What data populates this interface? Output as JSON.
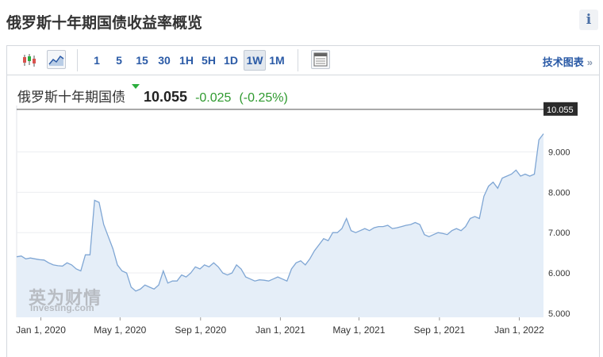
{
  "page_title": "俄罗斯十年期国债收益率概览",
  "info_label": "i",
  "toolbar": {
    "intervals": [
      "1",
      "5",
      "15",
      "30",
      "1H",
      "5H",
      "1D",
      "1W",
      "1M"
    ],
    "active_interval": "1W",
    "tech_chart_label": "技术图表",
    "tech_chart_arrow": "»"
  },
  "quote": {
    "name": "俄罗斯十年期国债",
    "price": "10.055",
    "change": "-0.025",
    "change_pct": "(-0.25%)",
    "change_color": "#2f9a2f"
  },
  "watermark": {
    "cn": "英为财情",
    "en": "Investing.com"
  },
  "chart_data": {
    "type": "area",
    "x_tick_labels": [
      "Jan 1, 2020",
      "May 1, 2020",
      "Sep 1, 2020",
      "Jan 1, 2021",
      "May 1, 2021",
      "Sep 1, 2021",
      "Jan 1, 2022"
    ],
    "y_tick_labels": [
      "5.000",
      "6.000",
      "7.000",
      "8.000",
      "9.000"
    ],
    "ylim": [
      4.9,
      10.15
    ],
    "last_value_label": "10.055",
    "x": [
      "2019-11-25",
      "2019-12-02",
      "2019-12-09",
      "2019-12-16",
      "2019-12-23",
      "2019-12-30",
      "2020-01-06",
      "2020-01-13",
      "2020-01-20",
      "2020-01-27",
      "2020-02-03",
      "2020-02-10",
      "2020-02-17",
      "2020-02-24",
      "2020-03-02",
      "2020-03-09",
      "2020-03-16",
      "2020-03-23",
      "2020-03-30",
      "2020-04-06",
      "2020-04-13",
      "2020-04-20",
      "2020-04-27",
      "2020-05-04",
      "2020-05-11",
      "2020-05-18",
      "2020-05-25",
      "2020-06-01",
      "2020-06-08",
      "2020-06-15",
      "2020-06-22",
      "2020-06-29",
      "2020-07-06",
      "2020-07-13",
      "2020-07-20",
      "2020-07-27",
      "2020-08-03",
      "2020-08-10",
      "2020-08-17",
      "2020-08-24",
      "2020-08-31",
      "2020-09-07",
      "2020-09-14",
      "2020-09-21",
      "2020-09-28",
      "2020-10-05",
      "2020-10-12",
      "2020-10-19",
      "2020-10-26",
      "2020-11-02",
      "2020-11-09",
      "2020-11-16",
      "2020-11-23",
      "2020-11-30",
      "2020-12-07",
      "2020-12-14",
      "2020-12-21",
      "2020-12-28",
      "2021-01-04",
      "2021-01-11",
      "2021-01-18",
      "2021-01-25",
      "2021-02-01",
      "2021-02-08",
      "2021-02-15",
      "2021-02-22",
      "2021-03-01",
      "2021-03-08",
      "2021-03-15",
      "2021-03-22",
      "2021-03-29",
      "2021-04-05",
      "2021-04-12",
      "2021-04-19",
      "2021-04-26",
      "2021-05-03",
      "2021-05-10",
      "2021-05-17",
      "2021-05-24",
      "2021-05-31",
      "2021-06-07",
      "2021-06-14",
      "2021-06-21",
      "2021-06-28",
      "2021-07-05",
      "2021-07-12",
      "2021-07-19",
      "2021-07-26",
      "2021-08-02",
      "2021-08-09",
      "2021-08-16",
      "2021-08-23",
      "2021-08-30",
      "2021-09-06",
      "2021-09-13",
      "2021-09-20",
      "2021-09-27",
      "2021-10-04",
      "2021-10-11",
      "2021-10-18",
      "2021-10-25",
      "2021-11-01",
      "2021-11-08",
      "2021-11-15",
      "2021-11-22",
      "2021-11-29",
      "2021-12-06",
      "2021-12-13",
      "2021-12-20",
      "2021-12-27",
      "2022-01-03",
      "2022-01-10",
      "2022-01-17",
      "2022-01-24",
      "2022-01-31",
      "2022-02-07"
    ],
    "values": [
      6.4,
      6.42,
      6.35,
      6.37,
      6.35,
      6.33,
      6.32,
      6.25,
      6.2,
      6.18,
      6.17,
      6.25,
      6.2,
      6.1,
      6.05,
      6.45,
      6.45,
      7.8,
      7.75,
      7.2,
      6.9,
      6.6,
      6.2,
      6.05,
      6.0,
      5.65,
      5.55,
      5.6,
      5.7,
      5.65,
      5.6,
      5.7,
      6.05,
      5.75,
      5.8,
      5.8,
      5.95,
      5.9,
      6.0,
      6.15,
      6.1,
      6.2,
      6.15,
      6.25,
      6.15,
      6.0,
      5.95,
      6.0,
      6.2,
      6.1,
      5.9,
      5.85,
      5.8,
      5.83,
      5.82,
      5.8,
      5.85,
      5.9,
      5.85,
      5.8,
      6.1,
      6.25,
      6.3,
      6.2,
      6.35,
      6.55,
      6.7,
      6.85,
      6.8,
      7.0,
      7.0,
      7.1,
      7.35,
      7.05,
      7.0,
      7.05,
      7.1,
      7.05,
      7.12,
      7.15,
      7.15,
      7.18,
      7.1,
      7.12,
      7.15,
      7.18,
      7.2,
      7.25,
      7.2,
      6.95,
      6.9,
      6.95,
      7.0,
      6.98,
      6.95,
      7.05,
      7.1,
      7.05,
      7.15,
      7.35,
      7.4,
      7.35,
      7.9,
      8.15,
      8.25,
      8.1,
      8.35,
      8.4,
      8.45,
      8.55,
      8.4,
      8.45,
      8.4,
      8.45,
      9.3,
      9.45,
      9.4,
      9.55,
      9.35,
      9.8,
      10.055
    ]
  }
}
